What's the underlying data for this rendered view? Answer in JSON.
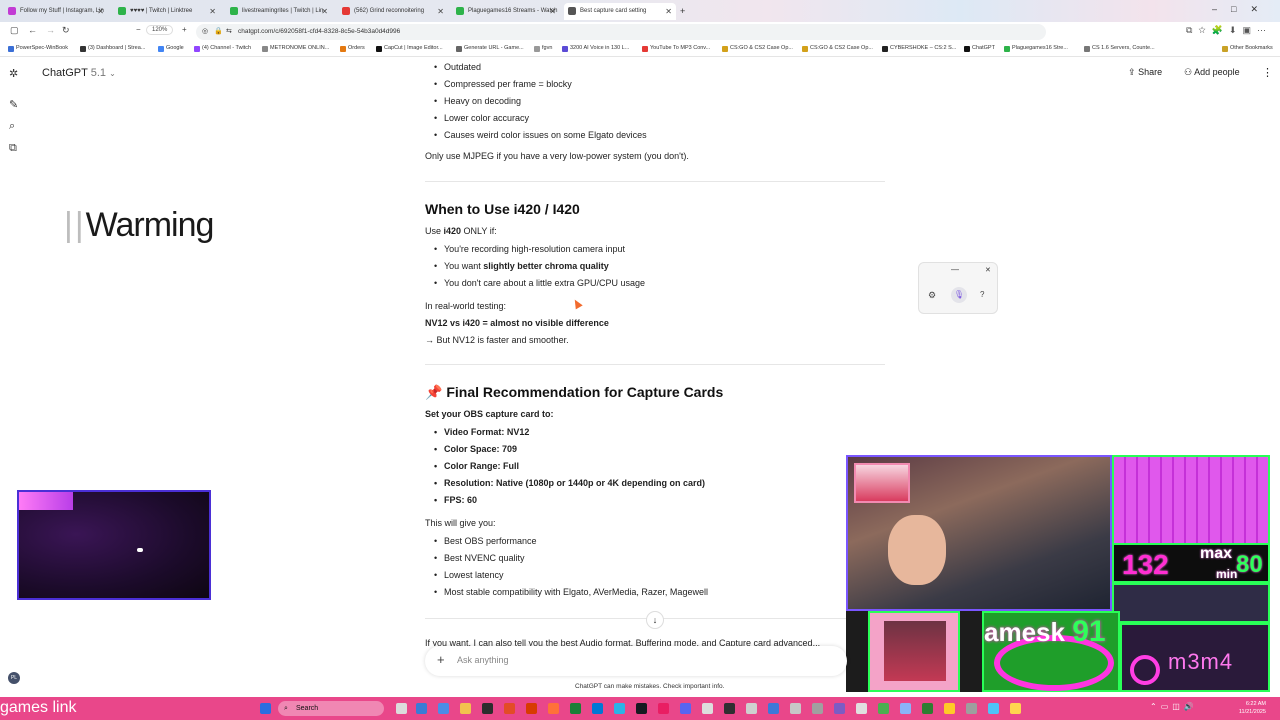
{
  "browser": {
    "tabs": [
      {
        "label": "Follow my Stuff | Instagram, Lin",
        "color": "#c23bd4"
      },
      {
        "label": "♥♥♥♥ | Twitch | Linktree",
        "color": "#2eb34a"
      },
      {
        "label": "livestreamingrites | Twitch | Lin",
        "color": "#2eb34a"
      },
      {
        "label": "(562) Grind reconnoitering",
        "color": "#e53935"
      },
      {
        "label": "Plaguegames16 Streams - Watch",
        "color": "#2eb34a"
      },
      {
        "label": "Best capture card setting",
        "color": "#555555"
      }
    ],
    "zoom": "120%",
    "url": "chatgpt.com/c/692058f1-cfd4-8328-8c5e-54b3a0d4d996",
    "bookmarks": [
      "PowerSpec-WinBook",
      "(3) Dashboard | Strea...",
      "Google",
      "(4) Channel - Twitch",
      "METRONOME ONLIN...",
      "Orders",
      "CapCut | Image Editor...",
      "Generate URL - Game...",
      "fgvn",
      "3200 AI Voice in 130 L...",
      "YouTube To MP3 Conv...",
      "CS:GO & CS2 Case Op...",
      "CS:GO & CS2 Case Op...",
      "CYBERSHOKE – CS:2 S...",
      "ChatGPT",
      "Plaguegames16 Stre...",
      "CS 1.6 Servers, Counte...",
      "Other Bookmarks"
    ]
  },
  "app": {
    "title": "ChatGPT",
    "version": "5.1",
    "share_label": "Share",
    "add_people_label": "Add people"
  },
  "chat": {
    "mjpeg_bullets": [
      "Outdated",
      "Compressed per frame = blocky",
      "Heavy on decoding",
      "Lower color accuracy",
      "Causes weird color issues on some Elgato devices"
    ],
    "mjpeg_note": "Only use MJPEG if you have a very low-power system (you don't).",
    "i420_heading": "When to Use i420 / I420",
    "i420_intro_pre": "Use ",
    "i420_intro_bold": "i420",
    "i420_intro_post": " ONLY if:",
    "i420_bullet1": "You're recording high-resolution camera input",
    "i420_bullet2_pre": "You want ",
    "i420_bullet2_bold": "slightly better chroma quality",
    "i420_bullet3": "You don't care about a little extra GPU/CPU usage",
    "realworld": "In real-world testing:",
    "nv12_vs": "NV12 vs i420 = almost no visible difference",
    "nv12_faster": "→ But NV12 is faster and smoother.",
    "final_pin": "📌",
    "final_heading": "Final Recommendation for Capture Cards",
    "obs_set": "Set your OBS capture card to:",
    "settings": [
      "Video Format: NV12",
      "Color Space: 709",
      "Color Range: Full",
      "Resolution: Native (1080p or 1440p or 4K depending on card)",
      "FPS: 60"
    ],
    "give_you": "This will give you:",
    "benefits": [
      "Best OBS performance",
      "Best NVENC quality",
      "Lowest latency",
      "Most stable compatibility with Elgato, AVerMedia, Razer, Magewell"
    ],
    "cutoff_text": "If you want, I can also tell you the best Audio format, Buffering mode, and Capture card advanced..."
  },
  "composer": {
    "placeholder": "Ask anything",
    "disclaimer": "ChatGPT can make mistakes. Check important info."
  },
  "overlays": {
    "warming_text": "Warming",
    "stat_max": "max",
    "stat_max_val": "80",
    "stat_min": "min",
    "stat_left": "132",
    "name_text": "amesk",
    "name_num": "91",
    "m3m4": "m3m4",
    "games_link": "games link"
  },
  "taskbar": {
    "search_label": "Search",
    "time": "6:22 AM",
    "date": "11/21/2025"
  }
}
